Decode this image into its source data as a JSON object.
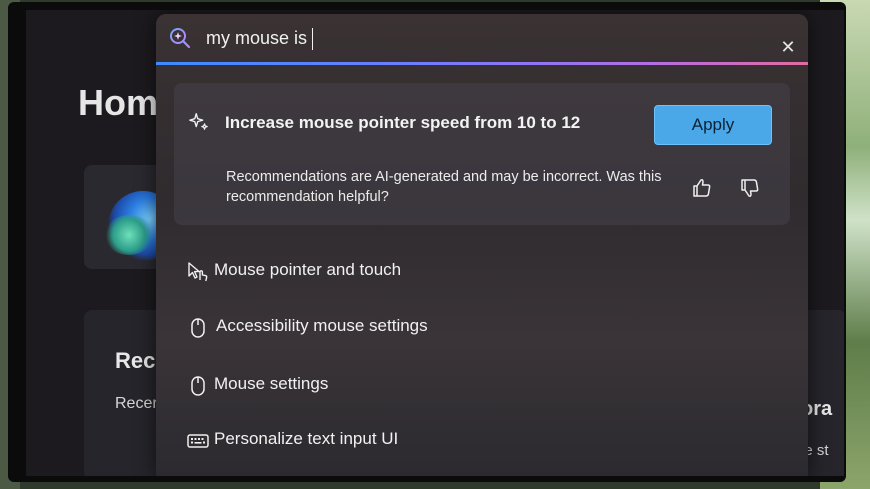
{
  "settings_app": {
    "home_title": "Hom",
    "recommended_title": "Rec",
    "recommended_sub": "Recer",
    "right_card_big": "ora",
    "right_card_small": "le st"
  },
  "search": {
    "query": "my mouse is",
    "close_label": "✕"
  },
  "recommendation": {
    "headline": "Increase mouse pointer speed from 10 to 12",
    "apply_label": "Apply",
    "disclaimer": "Recommendations are AI-generated and may be incorrect. Was this recommendation helpful?"
  },
  "results": [
    {
      "label": "Mouse pointer and touch",
      "icon": "pointer-touch-icon"
    },
    {
      "label": "Accessibility mouse settings",
      "icon": "mouse-icon"
    },
    {
      "label": "Mouse settings",
      "icon": "mouse-icon"
    },
    {
      "label": "Personalize text input UI",
      "icon": "keyboard-icon"
    }
  ],
  "colors": {
    "accent": "#4aa8e8",
    "gradient_start": "#3d8bff",
    "gradient_end": "#e46aa0"
  }
}
